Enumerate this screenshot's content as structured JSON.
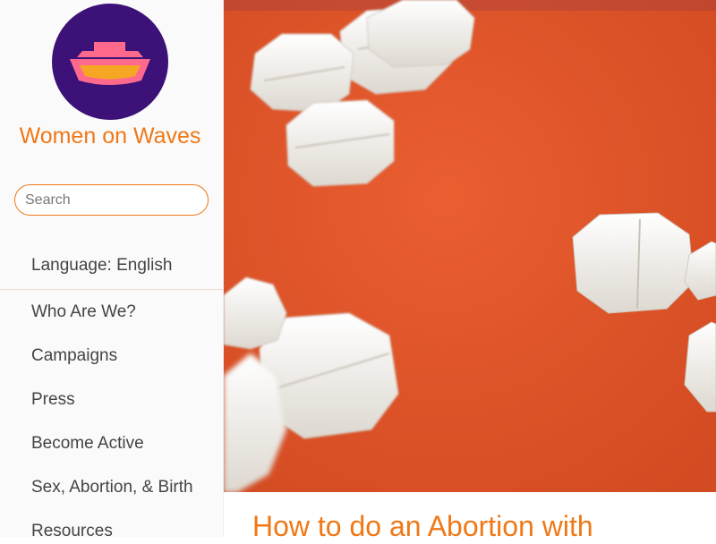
{
  "site": {
    "title": "Women on Waves"
  },
  "search": {
    "placeholder": "Search"
  },
  "language": {
    "label": "Language: English"
  },
  "nav": {
    "items": [
      "Who Are We?",
      "Campaigns",
      "Press",
      "Become Active",
      "Sex, Abortion, & Birth",
      "Resources"
    ]
  },
  "article": {
    "title": "How to do an Abortion with"
  },
  "colors": {
    "accent": "#ef7817",
    "logo_background": "#3c1178",
    "logo_ship": "#ff6a8c",
    "logo_hull": "#f5a623",
    "hero_background": "#e3562c",
    "pill": "#f3f1ec"
  },
  "icons": {
    "logo": "ship-logo-icon",
    "hero": "pills-photo"
  }
}
